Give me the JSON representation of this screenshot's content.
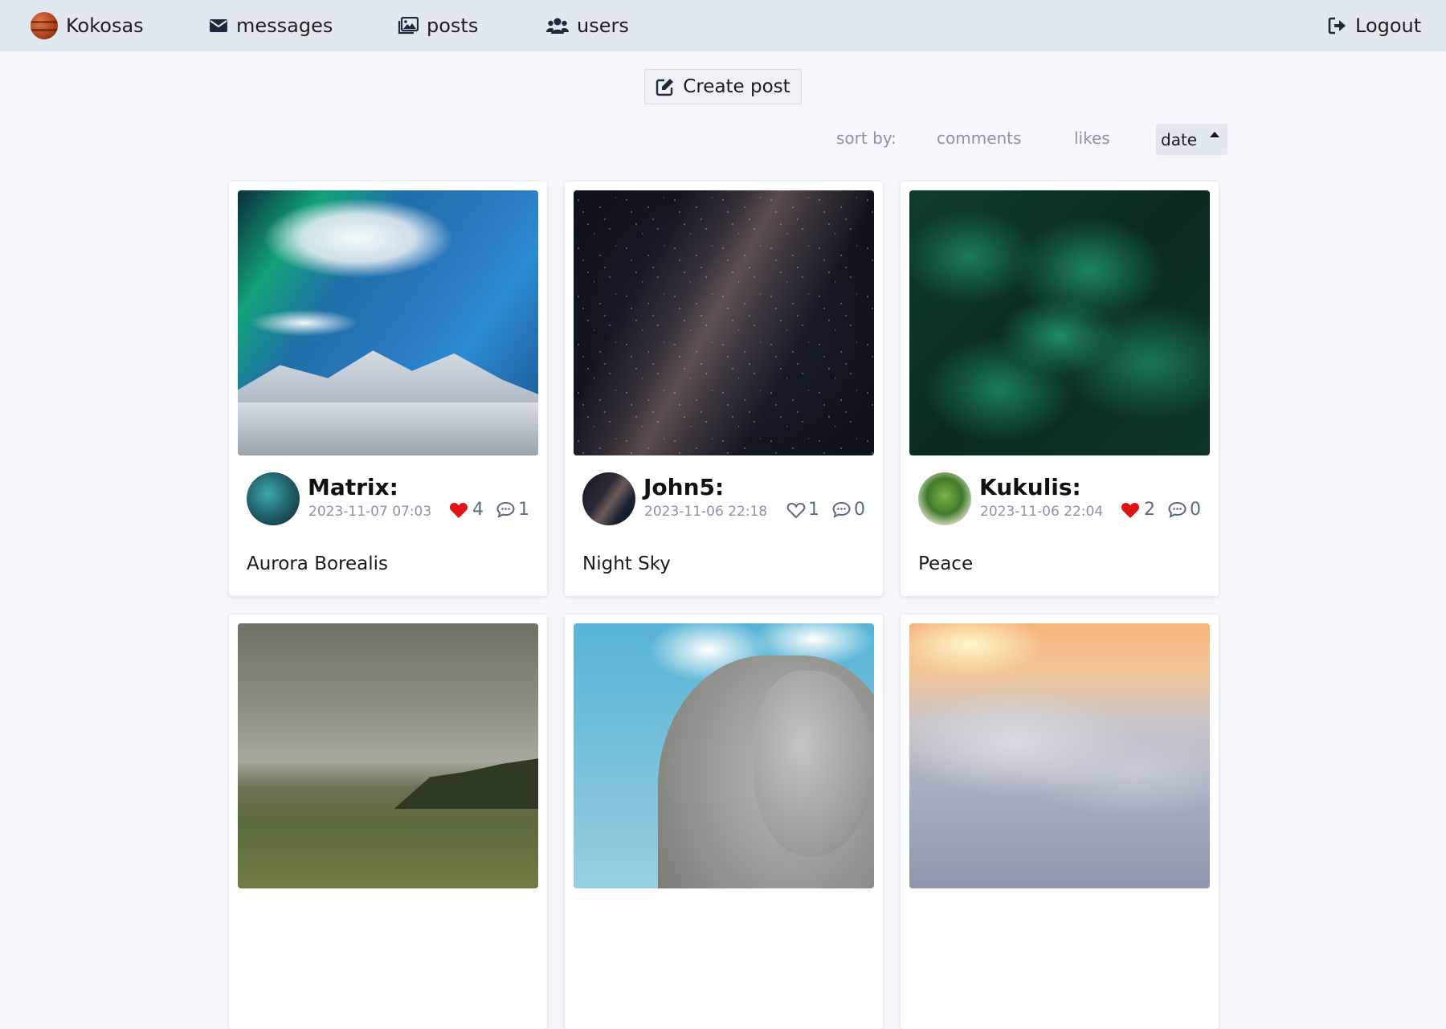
{
  "nav": {
    "brand": "Kokosas",
    "messages": "messages",
    "posts": "posts",
    "users": "users",
    "logout": "Logout"
  },
  "create_post_label": "Create post",
  "sort": {
    "label": "sort by:",
    "comments": "comments",
    "likes": "likes",
    "date": "date",
    "active": "date",
    "direction": "ascending"
  },
  "posts": [
    {
      "user": "Matrix:",
      "date": "2023-11-07 07:03",
      "likes": "4",
      "liked": true,
      "comments": "1",
      "caption": "Aurora Borealis",
      "image": "aurora-mountain-photo"
    },
    {
      "user": "John5:",
      "date": "2023-11-06 22:18",
      "likes": "1",
      "liked": false,
      "comments": "0",
      "caption": "Night Sky",
      "image": "milky-way-photo"
    },
    {
      "user": "Kukulis:",
      "date": "2023-11-06 22:04",
      "likes": "2",
      "liked": true,
      "comments": "0",
      "caption": "Peace",
      "image": "green-foliage-photo"
    },
    {
      "image": "misty-valley-photo"
    },
    {
      "image": "elephant-photo"
    },
    {
      "image": "sunset-clouds-photo"
    }
  ],
  "colors": {
    "nav_bg": "#e2e8f0",
    "page_bg": "#f4f7fb",
    "heart_liked": "#e11414",
    "muted": "#8a96a6"
  }
}
